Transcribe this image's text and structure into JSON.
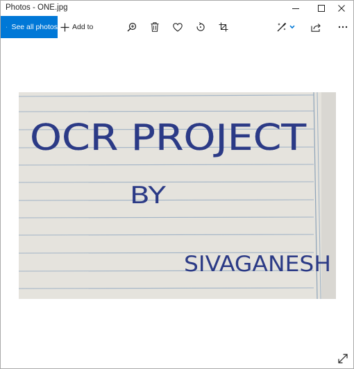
{
  "window": {
    "title": "Photos - ONE.jpg"
  },
  "toolbar": {
    "see_all_label": "See all photos",
    "add_to_label": "Add to"
  },
  "photo": {
    "lines": [
      "OCR PROJECT",
      "BY",
      "SIVAGANESH"
    ],
    "ink_color": "#2b3a86",
    "paper_color": "#e9e7e3",
    "rule_color": "#8ba4bf"
  },
  "colors": {
    "accent": "#0078d7",
    "window_bg": "#ffffff",
    "icon": "#1f1f1f"
  },
  "icons": [
    "photos-icon",
    "plus-icon",
    "zoom-in-icon",
    "delete-icon",
    "heart-icon",
    "rotate-icon",
    "crop-icon",
    "edit-create-icon",
    "chevron-down-icon",
    "share-icon",
    "more-icon",
    "expand-icon",
    "minimize-icon",
    "maximize-icon",
    "close-icon"
  ]
}
